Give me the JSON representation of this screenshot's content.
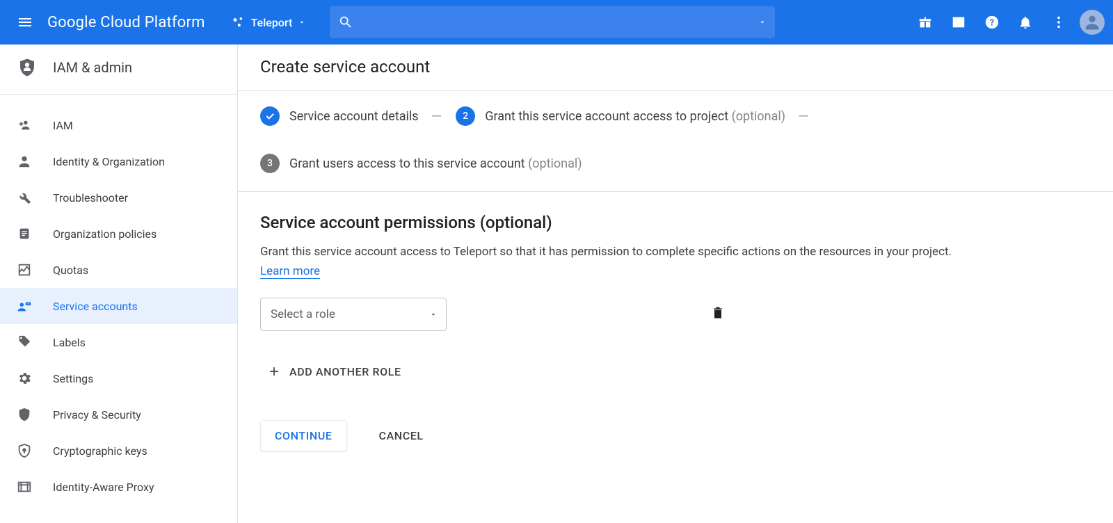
{
  "header": {
    "brand": "Google Cloud Platform",
    "project": "Teleport"
  },
  "sidebar": {
    "title": "IAM & admin",
    "items": [
      {
        "label": "IAM"
      },
      {
        "label": "Identity & Organization"
      },
      {
        "label": "Troubleshooter"
      },
      {
        "label": "Organization policies"
      },
      {
        "label": "Quotas"
      },
      {
        "label": "Service accounts"
      },
      {
        "label": "Labels"
      },
      {
        "label": "Settings"
      },
      {
        "label": "Privacy & Security"
      },
      {
        "label": "Cryptographic keys"
      },
      {
        "label": "Identity-Aware Proxy"
      }
    ]
  },
  "page": {
    "title": "Create service account",
    "stepper": {
      "step1": {
        "label": "Service account details"
      },
      "step2": {
        "num": "2",
        "label": "Grant this service account access to project",
        "optional": "(optional)"
      },
      "step3": {
        "num": "3",
        "label": "Grant users access to this service account",
        "optional": "(optional)"
      }
    },
    "form": {
      "heading": "Service account permissions (optional)",
      "desc1": "Grant this service account access to Teleport so that it has permission to complete specific actions on the resources in your project. ",
      "learn_more": "Learn more",
      "role_placeholder": "Select a role",
      "add_role": "ADD ANOTHER ROLE",
      "continue": "CONTINUE",
      "cancel": "CANCEL"
    }
  }
}
